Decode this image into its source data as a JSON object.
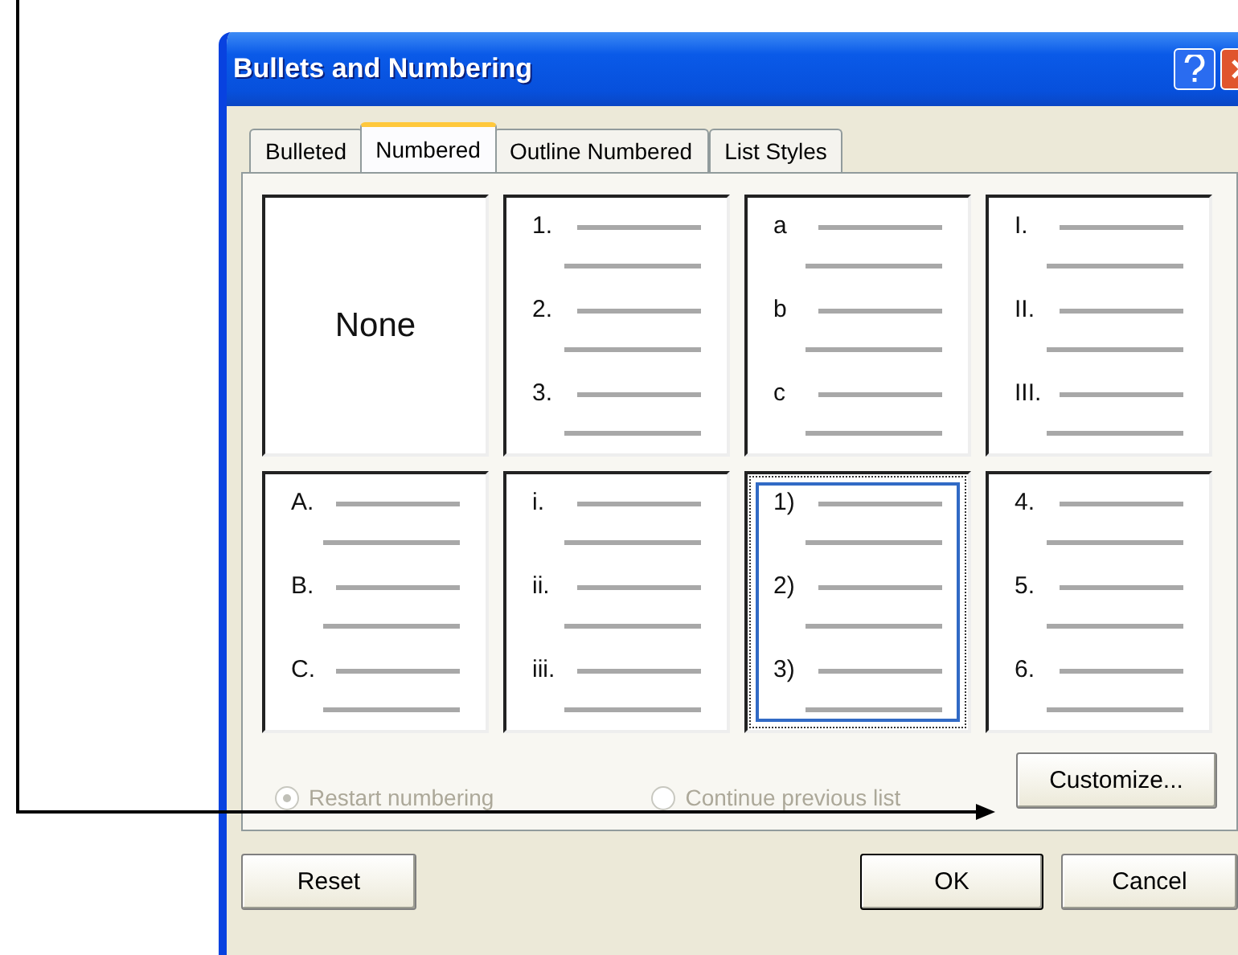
{
  "window": {
    "title": "Bullets and Numbering"
  },
  "tabs": [
    {
      "label": "Bulleted",
      "selected": false
    },
    {
      "label": "Numbered",
      "selected": true
    },
    {
      "label": "Outline Numbered",
      "selected": false
    },
    {
      "label": "List Styles",
      "selected": false
    }
  ],
  "styles": [
    {
      "kind": "none",
      "label": "None",
      "selected": false
    },
    {
      "kind": "list",
      "markers": [
        "1.",
        "2.",
        "3."
      ],
      "selected": false
    },
    {
      "kind": "list",
      "markers": [
        "a",
        "b",
        "c"
      ],
      "selected": false
    },
    {
      "kind": "list",
      "markers": [
        "I.",
        "II.",
        "III."
      ],
      "selected": false
    },
    {
      "kind": "list",
      "markers": [
        "A.",
        "B.",
        "C."
      ],
      "selected": false
    },
    {
      "kind": "list",
      "markers": [
        "i.",
        "ii.",
        "iii."
      ],
      "selected": false
    },
    {
      "kind": "list",
      "markers": [
        "1)",
        "2)",
        "3)"
      ],
      "selected": true
    },
    {
      "kind": "list",
      "markers": [
        "4.",
        "5.",
        "6."
      ],
      "selected": false
    }
  ],
  "options": [
    {
      "label": "Restart numbering",
      "selected": true,
      "disabled": true
    },
    {
      "label": "Continue previous list",
      "selected": false,
      "disabled": true
    }
  ],
  "customize_button": "Customize...",
  "buttons": [
    {
      "label": "Reset",
      "kind": "left"
    },
    {
      "label": "OK",
      "kind": "default"
    },
    {
      "label": "Cancel",
      "kind": "normal"
    }
  ]
}
